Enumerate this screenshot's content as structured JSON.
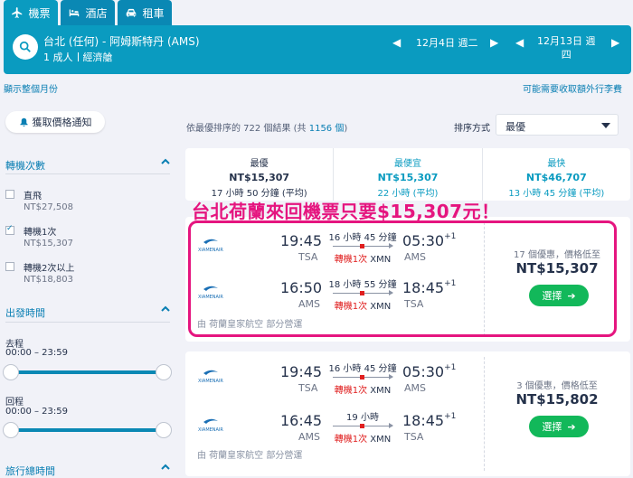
{
  "tabs": [
    {
      "label": "機票",
      "icon": "airplane-icon",
      "active": true
    },
    {
      "label": "酒店",
      "icon": "bed-icon"
    },
    {
      "label": "租車",
      "icon": "car-icon"
    }
  ],
  "search": {
    "route": "台北 (任何) - 阿姆斯特丹 (AMS)",
    "passengers": "1 成人",
    "cabin": "經濟艙",
    "depart_date": "12月4日 週二",
    "return_date_line1": "12月13日 週",
    "return_date_line2": "四"
  },
  "links": {
    "month_view": "顯示整個月份",
    "baggage_notice": "可能需要收取額外行李費"
  },
  "alert_button": "獲取價格通知",
  "filters": {
    "stops_title": "轉機次數",
    "stops": [
      {
        "label": "直飛",
        "price": "NT$27,508",
        "checked": false
      },
      {
        "label": "轉機1次",
        "price": "NT$15,307",
        "checked": true
      },
      {
        "label": "轉機2次以上",
        "price": "NT$18,803",
        "checked": false
      }
    ],
    "departure_title": "出發時間",
    "outbound_label": "去程",
    "outbound_range": "00:00 – 23:59",
    "return_label": "回程",
    "return_range": "00:00 – 23:59",
    "duration_title": "旅行總時間"
  },
  "results": {
    "meta_prefix": "依最優排序的 722 個結果 (共",
    "meta_total": "1156 個",
    "meta_suffix": ")",
    "sort_label": "排序方式",
    "sort_value": "最優"
  },
  "sort_tabs": [
    {
      "title": "最優",
      "price": "NT$15,307",
      "duration": "17 小時 50 分鐘 (平均)"
    },
    {
      "title": "最便宜",
      "price": "NT$15,307",
      "duration": "22 小時 (平均)"
    },
    {
      "title": "最快",
      "price": "NT$46,707",
      "duration": "13 小時 45 分鐘 (平均)"
    }
  ],
  "banner": "台北荷蘭來回機票只要$15,307元！",
  "flights": [
    {
      "legs": [
        {
          "dep_time": "19:45",
          "dep_code": "TSA",
          "duration": "16 小時 45 分鐘",
          "stop": "轉機1次",
          "stop_code": "XMN",
          "arr_time": "05:30",
          "arr_plus": "+1",
          "arr_code": "AMS"
        },
        {
          "dep_time": "16:50",
          "dep_code": "AMS",
          "duration": "18 小時 55 分鐘",
          "stop": "轉機1次",
          "stop_code": "XMN",
          "arr_time": "18:45",
          "arr_plus": "+1",
          "arr_code": "TSA"
        }
      ],
      "operator": "由 荷蘭皇家航空 部分營運",
      "deals": "17 個優惠，價格低至",
      "price": "NT$15,307",
      "select_label": "選擇",
      "airline_logo": "XIAMENAIR"
    },
    {
      "legs": [
        {
          "dep_time": "19:45",
          "dep_code": "TSA",
          "duration": "16 小時 45 分鐘",
          "stop": "轉機1次",
          "stop_code": "XMN",
          "arr_time": "05:30",
          "arr_plus": "+1",
          "arr_code": "AMS"
        },
        {
          "dep_time": "16:45",
          "dep_code": "AMS",
          "duration": "19 小時",
          "stop": "轉機1次",
          "stop_code": "XMN",
          "arr_time": "18:45",
          "arr_plus": "+1",
          "arr_code": "TSA"
        }
      ],
      "operator": "由 荷蘭皇家航空 部分營運",
      "deals": "3 個優惠，價格低至",
      "price": "NT$15,802",
      "select_label": "選擇",
      "airline_logo": "XIAMENAIR"
    }
  ],
  "colors": {
    "brand": "#0a9bc0",
    "accent": "#e5157f",
    "select": "#12b85a",
    "stop": "#e02020"
  }
}
